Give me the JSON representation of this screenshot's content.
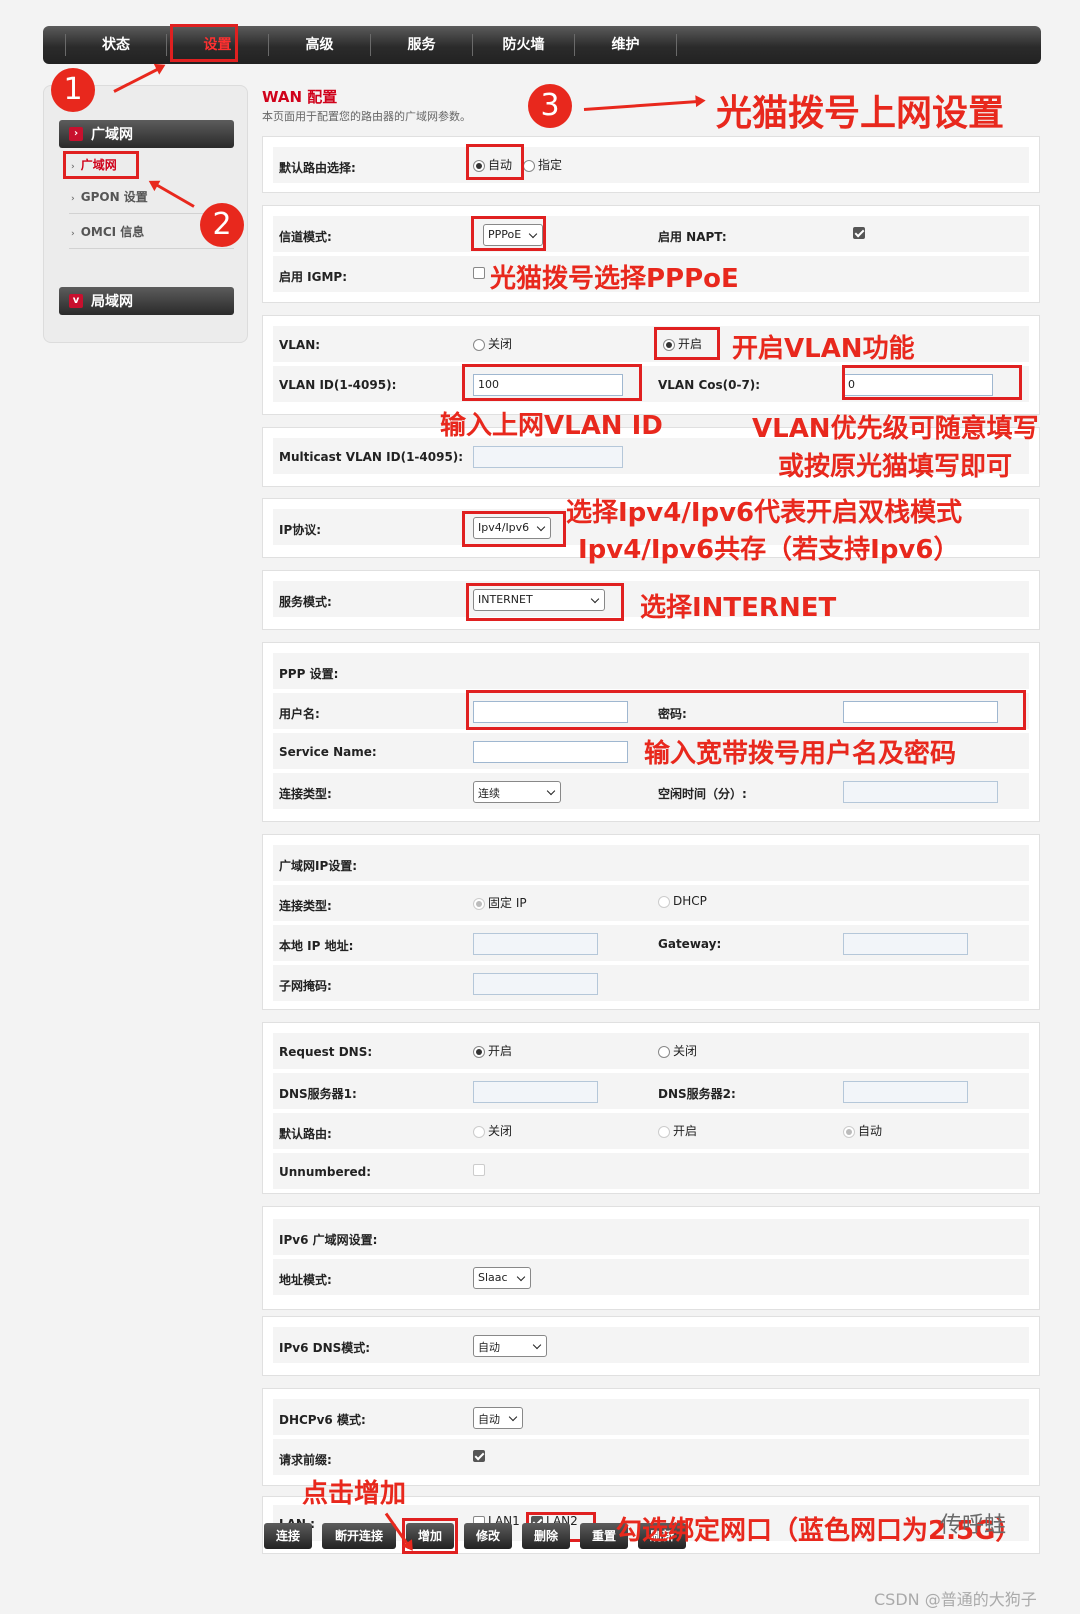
{
  "nav": {
    "items": [
      "状态",
      "设置",
      "高级",
      "服务",
      "防火墙",
      "维护"
    ]
  },
  "sidebar": {
    "section1": "广域网",
    "items": [
      "广域网",
      "GPON 设置",
      "OMCI 信息"
    ],
    "section2": "局域网"
  },
  "page": {
    "title": "WAN 配置",
    "description": "本页面用于配置您的路由器的广域网参数。"
  },
  "form": {
    "default_route": {
      "label": "默认路由选择:",
      "opt_auto": "自动",
      "opt_specify": "指定"
    },
    "channel_mode": {
      "label": "信道模式:",
      "value": "PPPoE",
      "napt_label": "启用 NAPT:"
    },
    "igmp": {
      "label": "启用 IGMP:"
    },
    "vlan": {
      "label": "VLAN:",
      "opt_off": "关闭",
      "opt_on": "开启"
    },
    "vlan_id": {
      "label": "VLAN ID(1-4095):",
      "value": "100",
      "cos_label": "VLAN Cos(0-7):",
      "cos_value": "0"
    },
    "mcast": {
      "label": "Multicast VLAN ID(1-4095):"
    },
    "ip_protocol": {
      "label": "IP协议:",
      "value": "Ipv4/Ipv6"
    },
    "service_mode": {
      "label": "服务模式:",
      "value": "INTERNET"
    },
    "ppp": {
      "section": "PPP 设置:",
      "username_label": "用户名:",
      "password_label": "密码:",
      "service_name_label": "Service Name:",
      "conn_type_label": "连接类型:",
      "conn_type_value": "连续",
      "idle_label": "空闲时间（分）:"
    },
    "wanip": {
      "section": "广域网IP设置:",
      "conn_type_label": "连接类型:",
      "opt_fixed": "固定 IP",
      "opt_dhcp": "DHCP",
      "local_ip_label": "本地 IP 地址:",
      "gateway_label": "Gateway:",
      "subnet_label": "子网掩码:"
    },
    "dns": {
      "request_label": "Request DNS:",
      "opt_on": "开启",
      "opt_off": "关闭",
      "dns1_label": "DNS服务器1:",
      "dns2_label": "DNS服务器2:",
      "default_route_label": "默认路由:",
      "dr_off": "关闭",
      "dr_on": "开启",
      "dr_auto": "自动",
      "unnumbered_label": "Unnumbered:"
    },
    "ipv6": {
      "section": "IPv6 广域网设置:",
      "addr_mode_label": "地址模式:",
      "addr_mode_value": "Slaac",
      "dns_mode_label": "IPv6 DNS模式:",
      "dns_mode_value": "自动",
      "dhcpv6_label": "DHCPv6 模式:",
      "dhcpv6_value": "自动",
      "prefix_label": "请求前缀:"
    },
    "lan": {
      "label": "LAN :",
      "lan1": "LAN1",
      "lan2": "LAN2"
    }
  },
  "buttons": [
    "连接",
    "断开连接",
    "增加",
    "修改",
    "删除",
    "重置",
    "刷新"
  ],
  "annotations": {
    "n1": "1",
    "n2": "2",
    "n3": "3",
    "a_title": "光猫拨号上网设置",
    "a_pppoe": "光猫拨号选择PPPoE",
    "a_vlan": "开启VLAN功能",
    "a_vlanid": "输入上网VLAN ID",
    "a_cos1": "VLAN优先级可随意填写",
    "a_cos2": "或按原光猫填写即可",
    "a_ip1": "选择Ipv4/Ipv6代表开启双栈模式",
    "a_ip2": "Ipv4/Ipv6共存（若支持Ipv6）",
    "a_internet": "选择INTERNET",
    "a_user": "输入宽带拨号用户名及密码",
    "a_add": "点击增加",
    "a_lan": "勾选绑定网口（蓝色网口为2.5G）"
  },
  "watermark": "传呼蛙",
  "credit": "CSDN @普通的大狗子",
  "colors": {
    "annotation": "#e8281d",
    "title": "#d0021b"
  }
}
